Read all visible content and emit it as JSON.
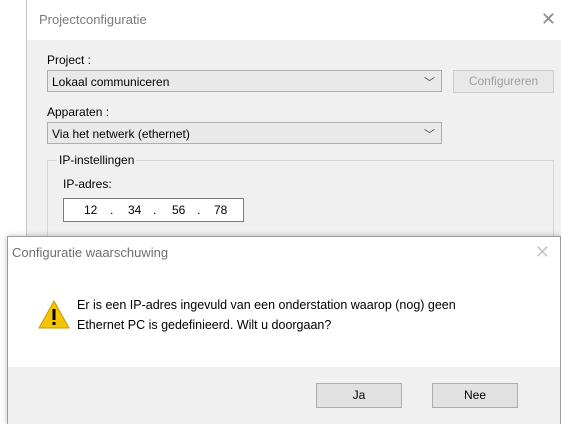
{
  "back_window": {
    "title": "Projectconfiguratie",
    "project_label": "Project :",
    "project_value": "Lokaal communiceren",
    "configure_label": "Configureren",
    "devices_label": "Apparaten :",
    "devices_value": "Via het netwerk (ethernet)",
    "ip_group_title": "IP-instellingen",
    "ip_label": "IP-adres:",
    "ip": [
      "12",
      "34",
      "56",
      "78"
    ],
    "ip_dot": "."
  },
  "dialog": {
    "title": "Configuratie waarschuwing",
    "message_line1": "Er is een IP-adres ingevuld van een onderstation waarop (nog) geen",
    "message_line2": "Ethernet PC is gedefinieerd. Wilt u doorgaan?",
    "yes_label": "Ja",
    "no_label": "Nee"
  },
  "icons": {
    "close": "close-icon",
    "chevron": "chevron-down-icon",
    "warning": "warning-icon"
  },
  "colors": {
    "warning_fill": "#f5c400",
    "window_bg": "#f0f0f0"
  }
}
